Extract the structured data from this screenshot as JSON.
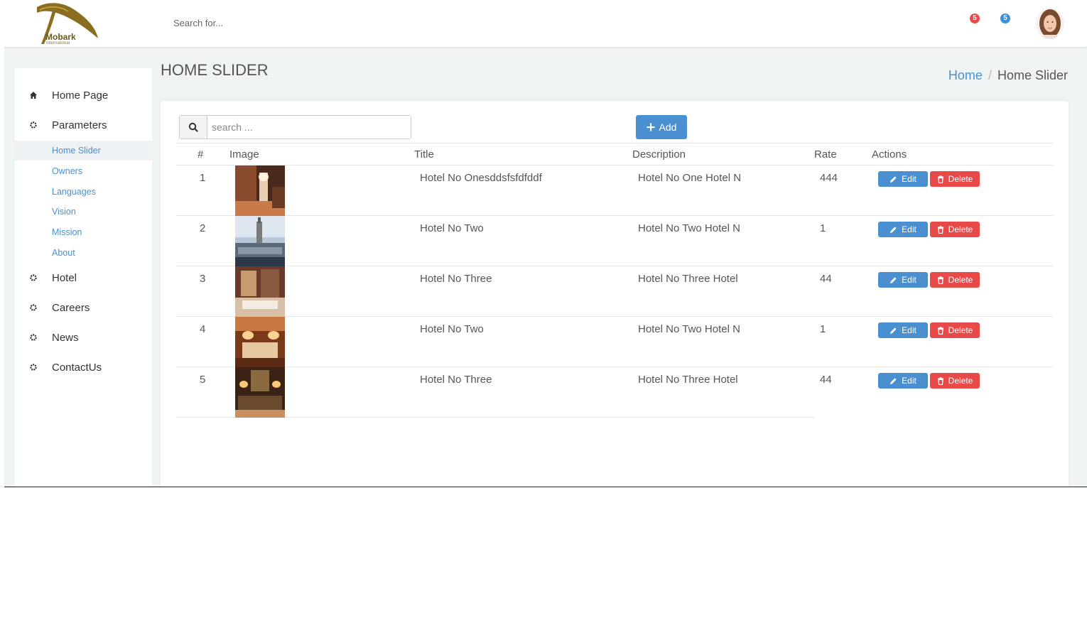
{
  "header": {
    "logo_text": "Mobark",
    "logo_sub": "International",
    "search_placeholder": "Search for...",
    "notif_red": "5",
    "notif_blue": "5"
  },
  "sidebar": {
    "items": [
      {
        "label": "Home Page",
        "icon": "home-icon"
      },
      {
        "label": "Parameters",
        "icon": "gear-icon"
      },
      {
        "label": "Hotel",
        "icon": "gear-icon"
      },
      {
        "label": "Careers",
        "icon": "gear-icon"
      },
      {
        "label": "News",
        "icon": "gear-icon"
      },
      {
        "label": "ContactUs",
        "icon": "gear-icon"
      }
    ],
    "sub_items": [
      {
        "label": "Home Slider",
        "active": true
      },
      {
        "label": "Owners"
      },
      {
        "label": "Languages"
      },
      {
        "label": "Vision"
      },
      {
        "label": "Mission"
      },
      {
        "label": "About"
      }
    ]
  },
  "page": {
    "title": "HOME SLIDER",
    "breadcrumb_home": "Home",
    "breadcrumb_sep": "/",
    "breadcrumb_current": "Home Slider"
  },
  "toolbar": {
    "search_placeholder": "search ...",
    "add_label": "Add"
  },
  "table": {
    "columns": [
      "#",
      "Image",
      "Title",
      "Description",
      "Rate",
      "Actions"
    ],
    "edit_label": "Edit",
    "delete_label": "Delete",
    "rows": [
      {
        "num": "1",
        "title": "Hotel No Onesddsfsfdfddf",
        "description": "Hotel No One Hotel N",
        "rate": "444"
      },
      {
        "num": "2",
        "title": "Hotel No Two",
        "description": "Hotel No Two Hotel N",
        "rate": "1"
      },
      {
        "num": "3",
        "title": "Hotel No Three",
        "description": "Hotel No Three Hotel",
        "rate": "44"
      },
      {
        "num": "4",
        "title": "Hotel No Two",
        "description": "Hotel No Two Hotel N",
        "rate": "1"
      },
      {
        "num": "5",
        "title": "Hotel No Three",
        "description": "Hotel No Three Hotel",
        "rate": "44"
      }
    ]
  },
  "colors": {
    "accent": "#4a90d0",
    "danger": "#e84a4a",
    "background": "#f0f3f4"
  }
}
